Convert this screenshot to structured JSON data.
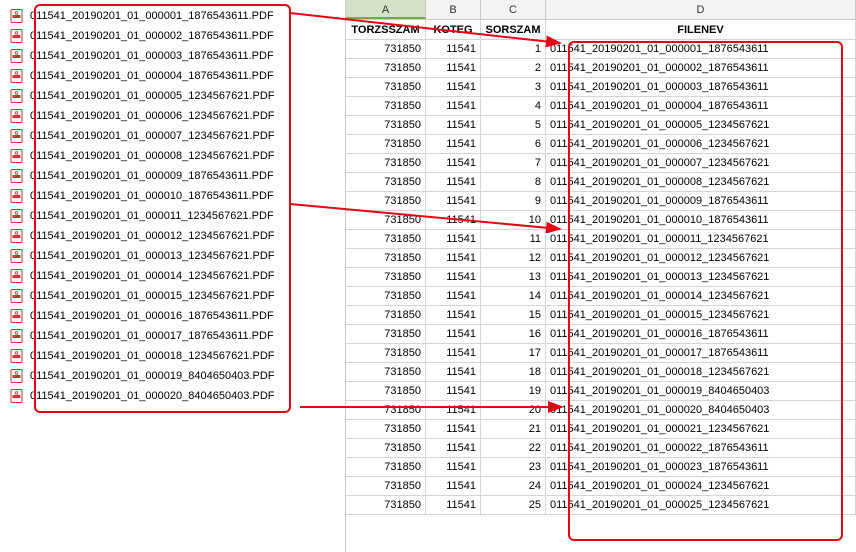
{
  "file_list": [
    "011541_20190201_01_000001_1876543611.PDF",
    "011541_20190201_01_000002_1876543611.PDF",
    "011541_20190201_01_000003_1876543611.PDF",
    "011541_20190201_01_000004_1876543611.PDF",
    "011541_20190201_01_000005_1234567621.PDF",
    "011541_20190201_01_000006_1234567621.PDF",
    "011541_20190201_01_000007_1234567621.PDF",
    "011541_20190201_01_000008_1234567621.PDF",
    "011541_20190201_01_000009_1876543611.PDF",
    "011541_20190201_01_000010_1876543611.PDF",
    "011541_20190201_01_000011_1234567621.PDF",
    "011541_20190201_01_000012_1234567621.PDF",
    "011541_20190201_01_000013_1234567621.PDF",
    "011541_20190201_01_000014_1234567621.PDF",
    "011541_20190201_01_000015_1234567621.PDF",
    "011541_20190201_01_000016_1876543611.PDF",
    "011541_20190201_01_000017_1876543611.PDF",
    "011541_20190201_01_000018_1234567621.PDF",
    "011541_20190201_01_000019_8404650403.PDF",
    "011541_20190201_01_000020_8404650403.PDF"
  ],
  "columns": [
    "A",
    "B",
    "C",
    "D"
  ],
  "headers": {
    "a": "TORZSSZAM",
    "b": "KOTEG",
    "c": "SORSZAM",
    "d": "FILENEV"
  },
  "rows": [
    {
      "a": "731850",
      "b": "11541",
      "c": "1",
      "d": "011541_20190201_01_000001_1876543611"
    },
    {
      "a": "731850",
      "b": "11541",
      "c": "2",
      "d": "011541_20190201_01_000002_1876543611"
    },
    {
      "a": "731850",
      "b": "11541",
      "c": "3",
      "d": "011541_20190201_01_000003_1876543611"
    },
    {
      "a": "731850",
      "b": "11541",
      "c": "4",
      "d": "011541_20190201_01_000004_1876543611"
    },
    {
      "a": "731850",
      "b": "11541",
      "c": "5",
      "d": "011541_20190201_01_000005_1234567621"
    },
    {
      "a": "731850",
      "b": "11541",
      "c": "6",
      "d": "011541_20190201_01_000006_1234567621"
    },
    {
      "a": "731850",
      "b": "11541",
      "c": "7",
      "d": "011541_20190201_01_000007_1234567621"
    },
    {
      "a": "731850",
      "b": "11541",
      "c": "8",
      "d": "011541_20190201_01_000008_1234567621"
    },
    {
      "a": "731850",
      "b": "11541",
      "c": "9",
      "d": "011541_20190201_01_000009_1876543611"
    },
    {
      "a": "731850",
      "b": "11541",
      "c": "10",
      "d": "011541_20190201_01_000010_1876543611"
    },
    {
      "a": "731850",
      "b": "11541",
      "c": "11",
      "d": "011541_20190201_01_000011_1234567621"
    },
    {
      "a": "731850",
      "b": "11541",
      "c": "12",
      "d": "011541_20190201_01_000012_1234567621"
    },
    {
      "a": "731850",
      "b": "11541",
      "c": "13",
      "d": "011541_20190201_01_000013_1234567621"
    },
    {
      "a": "731850",
      "b": "11541",
      "c": "14",
      "d": "011541_20190201_01_000014_1234567621"
    },
    {
      "a": "731850",
      "b": "11541",
      "c": "15",
      "d": "011541_20190201_01_000015_1234567621"
    },
    {
      "a": "731850",
      "b": "11541",
      "c": "16",
      "d": "011541_20190201_01_000016_1876543611"
    },
    {
      "a": "731850",
      "b": "11541",
      "c": "17",
      "d": "011541_20190201_01_000017_1876543611"
    },
    {
      "a": "731850",
      "b": "11541",
      "c": "18",
      "d": "011541_20190201_01_000018_1234567621"
    },
    {
      "a": "731850",
      "b": "11541",
      "c": "19",
      "d": "011541_20190201_01_000019_8404650403"
    },
    {
      "a": "731850",
      "b": "11541",
      "c": "20",
      "d": "011541_20190201_01_000020_8404650403"
    },
    {
      "a": "731850",
      "b": "11541",
      "c": "21",
      "d": "011541_20190201_01_000021_1234567621"
    },
    {
      "a": "731850",
      "b": "11541",
      "c": "22",
      "d": "011541_20190201_01_000022_1876543611"
    },
    {
      "a": "731850",
      "b": "11541",
      "c": "23",
      "d": "011541_20190201_01_000023_1876543611"
    },
    {
      "a": "731850",
      "b": "11541",
      "c": "24",
      "d": "011541_20190201_01_000024_1234567621"
    },
    {
      "a": "731850",
      "b": "11541",
      "c": "25",
      "d": "011541_20190201_01_000025_1234567621"
    }
  ]
}
